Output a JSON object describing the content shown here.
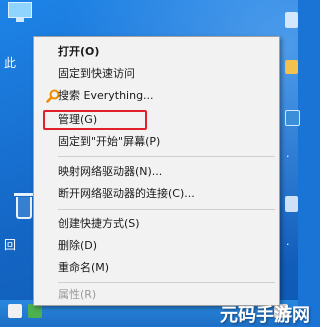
{
  "desktop": {
    "fragments": [
      "此",
      "回",
      "·",
      "·"
    ]
  },
  "context_menu": {
    "items": [
      {
        "label": "打开(O)",
        "bold": true
      },
      {
        "label": "固定到快速访问"
      },
      {
        "label": "搜索 Everything...",
        "icon": "everything-search-icon"
      },
      {
        "label": "管理(G)",
        "highlighted": true
      },
      {
        "label": "固定到\"开始\"屏幕(P)"
      },
      {
        "label": "映射网络驱动器(N)..."
      },
      {
        "label": "断开网络驱动器的连接(C)..."
      },
      {
        "label": "创建快捷方式(S)"
      },
      {
        "label": "删除(D)"
      },
      {
        "label": "重命名(M)"
      },
      {
        "label": "属性(R)",
        "disabled": true
      }
    ],
    "highlight_color": "#e0202a"
  },
  "watermark": {
    "text": "元码手游网"
  }
}
